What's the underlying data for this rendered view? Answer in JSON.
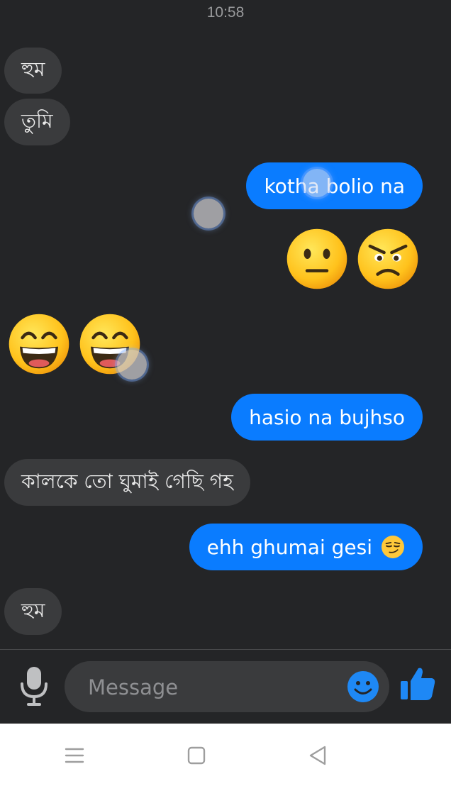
{
  "status": {
    "time": "10:58"
  },
  "messages": [
    {
      "side": "in",
      "text": "হুম"
    },
    {
      "side": "in",
      "text": "তুমি"
    },
    {
      "side": "out",
      "text": "kotha bolio na"
    },
    {
      "side": "out",
      "emojis": [
        "neutral-face",
        "pouting-face"
      ]
    },
    {
      "side": "in",
      "emojis": [
        "grinning-squinting-face",
        "grinning-squinting-face"
      ]
    },
    {
      "side": "out",
      "text": "hasio na bujhso"
    },
    {
      "side": "in",
      "text": "কালকে তো ঘুমাই গেছি গহ"
    },
    {
      "side": "out",
      "text": "ehh ghumai gesi",
      "trailing_emoji": "smirking-face"
    },
    {
      "side": "in",
      "text": "হুম"
    }
  ],
  "composer": {
    "placeholder": "Message",
    "value": "",
    "icons": [
      "microphone-icon",
      "emoji-smile-icon",
      "thumbs-up-icon"
    ]
  },
  "navbar": {
    "icons": [
      "menu-icon",
      "home-square-icon",
      "back-triangle-icon"
    ]
  },
  "colors": {
    "background": "#242527",
    "incoming_bubble": "#3a3b3d",
    "outgoing_bubble": "#0a7cff",
    "accent": "#1e88f5"
  }
}
